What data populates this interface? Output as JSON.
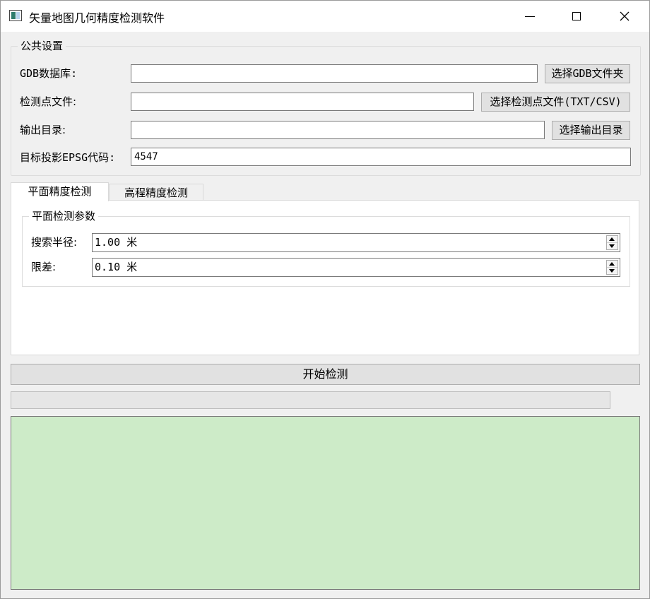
{
  "window": {
    "title": "矢量地图几何精度检测软件"
  },
  "common_settings": {
    "group_title": "公共设置",
    "gdb": {
      "label": "GDB数据库:",
      "value": "",
      "button": "选择GDB文件夹"
    },
    "check_points": {
      "label": "检测点文件:",
      "value": "",
      "button": "选择检测点文件(TXT/CSV)"
    },
    "output_dir": {
      "label": "输出目录:",
      "value": "",
      "button": "选择输出目录"
    },
    "epsg": {
      "label": "目标投影EPSG代码:",
      "value": "4547"
    }
  },
  "tabs": [
    {
      "label": "平面精度检测",
      "active": true
    },
    {
      "label": "高程精度检测",
      "active": false
    }
  ],
  "planar_params": {
    "group_title": "平面检测参数",
    "search_radius": {
      "label": "搜索半径:",
      "value": "1.00 米"
    },
    "tolerance": {
      "label": "限差:",
      "value": "0.10 米"
    }
  },
  "start_button": "开始检测",
  "progress": {
    "percent": 0
  },
  "log": {
    "text": ""
  },
  "colors": {
    "log_background": "#cdebc8",
    "window_background": "#f0f0f0"
  }
}
